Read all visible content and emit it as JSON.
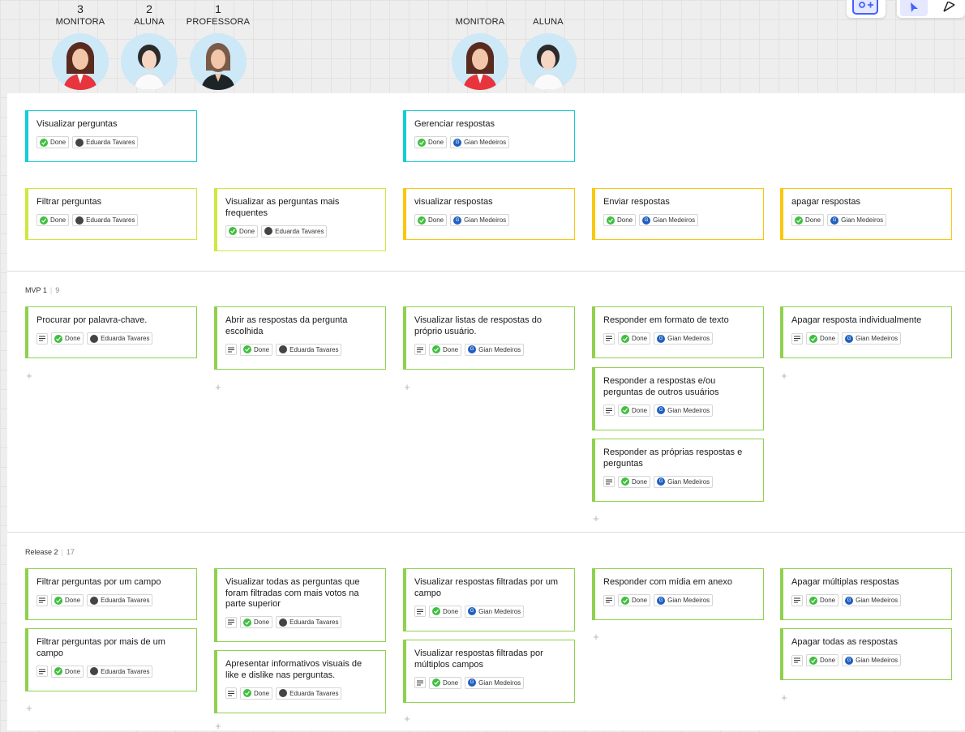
{
  "personas": [
    {
      "count": "3",
      "role": "MONITORA",
      "avatar": "woman-red-jacket-avatar"
    },
    {
      "count": "2",
      "role": "ALUNA",
      "avatar": "woman-white-shirt-avatar"
    },
    {
      "count": "1",
      "role": "PROFESSORA",
      "avatar": "woman-dark-jacket-avatar"
    },
    {
      "count": "",
      "role": "MONITORA",
      "avatar": "woman-red-jacket-avatar"
    },
    {
      "count": "",
      "role": "ALUNA",
      "avatar": "woman-white-shirt-avatar"
    }
  ],
  "toolbar": {
    "add_member_icon": "add-member-icon",
    "select_icon": "select-arrow-icon",
    "pen_icon": "pen-icon"
  },
  "activities": [
    {
      "title": "Visualizar perguntas",
      "status": "Done",
      "assignee": "Eduarda Tavares",
      "color": "cyan"
    },
    {
      "title": "Gerenciar respostas",
      "status": "Done",
      "assignee": "Gian Medeiros",
      "color": "cyan"
    }
  ],
  "tasks": [
    {
      "title": "Filtrar perguntas",
      "status": "Done",
      "assignee": "Eduarda Tavares",
      "color": "lime"
    },
    {
      "title": "Visualizar as perguntas mais frequentes",
      "status": "Done",
      "assignee": "Eduarda Tavares",
      "color": "lime"
    },
    {
      "title": "visualizar respostas",
      "status": "Done",
      "assignee": "Gian Medeiros",
      "color": "yellow"
    },
    {
      "title": "Enviar respostas",
      "status": "Done",
      "assignee": "Gian Medeiros",
      "color": "yellow"
    },
    {
      "title": "apagar respostas",
      "status": "Done",
      "assignee": "Gian Medeiros",
      "color": "yellow"
    }
  ],
  "lanes": [
    {
      "name": "MVP 1",
      "count": "9"
    },
    {
      "name": "Release 2",
      "count": "17"
    }
  ],
  "mvp_cards": [
    {
      "title": "Procurar por palavra-chave.",
      "status": "Done",
      "assignee": "Eduarda Tavares"
    },
    {
      "title": "Abrir as respostas da pergunta escolhida",
      "status": "Done",
      "assignee": "Eduarda Tavares"
    },
    {
      "title": "Visualizar listas de respostas do próprio usuário.",
      "status": "Done",
      "assignee": "Gian Medeiros"
    },
    {
      "title": "Responder em formato de texto",
      "status": "Done",
      "assignee": "Gian Medeiros"
    },
    {
      "title": "Responder a respostas e/ou perguntas de outros usuários",
      "status": "Done",
      "assignee": "Gian Medeiros"
    },
    {
      "title": "Responder as próprias respostas e perguntas",
      "status": "Done",
      "assignee": "Gian Medeiros"
    },
    {
      "title": "Apagar resposta individualmente",
      "status": "Done",
      "assignee": "Gian Medeiros"
    }
  ],
  "release_cards": [
    {
      "title": "Filtrar perguntas por um campo",
      "status": "Done",
      "assignee": "Eduarda Tavares"
    },
    {
      "title": "Filtrar perguntas por mais de um campo",
      "status": "Done",
      "assignee": "Eduarda Tavares"
    },
    {
      "title": "Visualizar todas as perguntas que foram filtradas com mais votos na parte superior",
      "status": "Done",
      "assignee": "Eduarda Tavares"
    },
    {
      "title": "Apresentar informativos visuais de like e dislike nas perguntas.",
      "status": "Done",
      "assignee": "Eduarda Tavares"
    },
    {
      "title": "Visualizar respostas filtradas por um campo",
      "status": "Done",
      "assignee": "Gian Medeiros"
    },
    {
      "title": "Visualizar respostas filtradas por múltiplos campos",
      "status": "Done",
      "assignee": "Gian Medeiros"
    },
    {
      "title": "Responder com mídia em anexo",
      "status": "Done",
      "assignee": "Gian Medeiros"
    },
    {
      "title": "Apagar múltiplas respostas",
      "status": "Done",
      "assignee": "Gian Medeiros"
    },
    {
      "title": "Apagar todas as respostas",
      "status": "Done",
      "assignee": "Gian Medeiros"
    }
  ],
  "add_card_symbol": "+",
  "colors": {
    "cyan": "#12cdd4",
    "lime": "#cee741",
    "yellow": "#fac710",
    "green": "#8fd14f",
    "done": "#3fbf3f"
  }
}
